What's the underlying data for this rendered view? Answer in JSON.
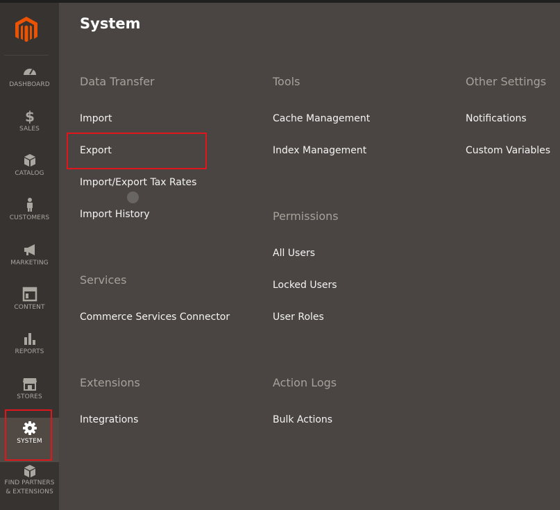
{
  "sidebar": {
    "items": [
      {
        "label": "DASHBOARD",
        "icon": "dashboard-icon"
      },
      {
        "label": "SALES",
        "icon": "dollar-icon"
      },
      {
        "label": "CATALOG",
        "icon": "box-icon"
      },
      {
        "label": "CUSTOMERS",
        "icon": "person-icon"
      },
      {
        "label": "MARKETING",
        "icon": "megaphone-icon"
      },
      {
        "label": "CONTENT",
        "icon": "layout-icon"
      },
      {
        "label": "REPORTS",
        "icon": "bar-chart-icon"
      },
      {
        "label": "STORES",
        "icon": "storefront-icon"
      },
      {
        "label": "SYSTEM",
        "icon": "gear-icon",
        "active": true
      },
      {
        "label": "FIND PARTNERS",
        "label2": "& EXTENSIONS",
        "icon": "package-icon"
      }
    ]
  },
  "panel": {
    "title": "System",
    "data_transfer": {
      "title": "Data Transfer",
      "links": [
        "Import",
        "Export",
        "Import/Export Tax Rates",
        "Import History"
      ]
    },
    "services": {
      "title": "Services",
      "links": [
        "Commerce Services Connector"
      ]
    },
    "extensions": {
      "title": "Extensions",
      "links": [
        "Integrations"
      ]
    },
    "tools": {
      "title": "Tools",
      "links": [
        "Cache Management",
        "Index Management"
      ]
    },
    "permissions": {
      "title": "Permissions",
      "links": [
        "All Users",
        "Locked Users",
        "User Roles"
      ]
    },
    "action_logs": {
      "title": "Action Logs",
      "links": [
        "Bulk Actions"
      ]
    },
    "other_settings": {
      "title": "Other Settings",
      "links": [
        "Notifications",
        "Custom Variables"
      ]
    }
  },
  "colors": {
    "brand": "#eb5202",
    "highlight": "#e0161c",
    "panel_bg": "#4a4542",
    "sidebar_bg": "#373330"
  }
}
